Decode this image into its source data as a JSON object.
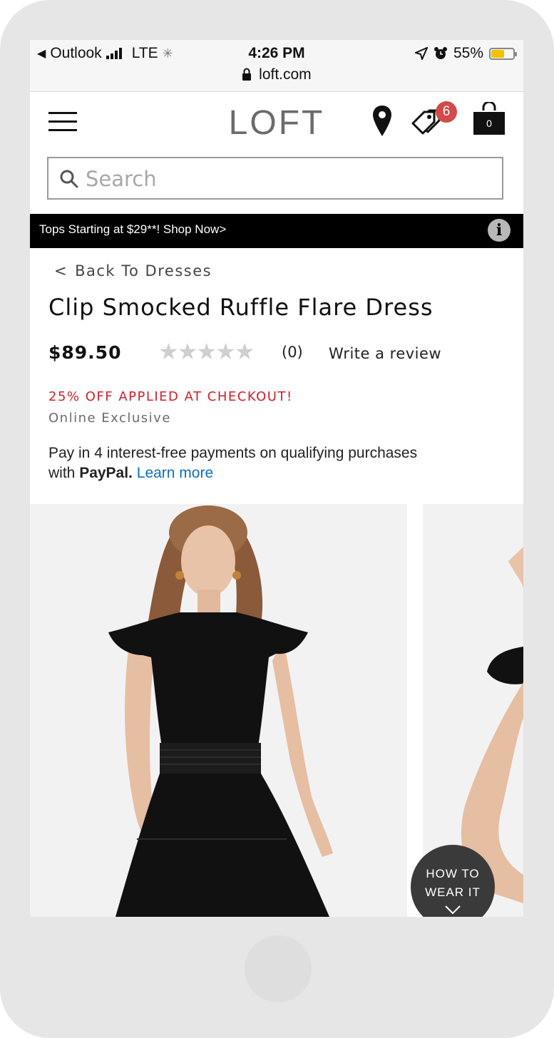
{
  "status_bar": {
    "back_app": "Outlook",
    "network": "LTE",
    "time": "4:26 PM",
    "battery": "55%",
    "battery_level": 0.55,
    "url": "loft.com"
  },
  "header": {
    "logo": "LOFT",
    "tag_badge_count": "6",
    "bag_count": "0"
  },
  "search": {
    "placeholder": "Search"
  },
  "promo": {
    "text": "Tops Starting at $29**! Shop Now>"
  },
  "product": {
    "back_label": "Back To Dresses",
    "title": "Clip Smocked Ruffle Flare Dress",
    "price": "$89.50",
    "rating_stars": "★★★★★",
    "review_count": "(0)",
    "write_review": "Write a review",
    "discount": "25% OFF APPLIED AT CHECKOUT!",
    "exclusive": "Online Exclusive",
    "paypal_line1": "Pay in 4 interest-free payments on qualifying purchases",
    "paypal_prefix": "with ",
    "paypal_brand": "PayPal.",
    "paypal_link": "Learn more"
  },
  "gallery": {
    "how_to_wear_line1": "HOW TO",
    "how_to_wear_line2": "WEAR IT"
  },
  "colors": {
    "promo_bg": "#000000",
    "discount": "#d0202a",
    "link": "#0b6fc4",
    "badge": "#d34a4a",
    "battery": "#f2c200"
  }
}
